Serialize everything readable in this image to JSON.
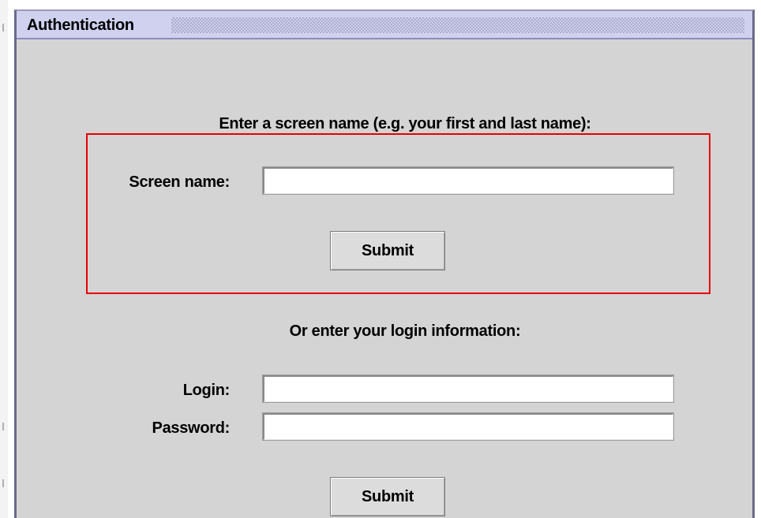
{
  "window": {
    "title": "Authentication"
  },
  "screen_name_section": {
    "prompt": "Enter a screen name (e.g. your first and last name):",
    "field_label": "Screen name:",
    "field_value": "",
    "submit_label": "Submit"
  },
  "login_section": {
    "prompt": "Or enter your login information:",
    "login_label": "Login:",
    "login_value": "",
    "password_label": "Password:",
    "password_value": "",
    "submit_label": "Submit"
  },
  "colors": {
    "dialog_bg": "#d4d4d4",
    "titlebar_bg": "#cfd1ef",
    "highlight": "#e80000"
  }
}
